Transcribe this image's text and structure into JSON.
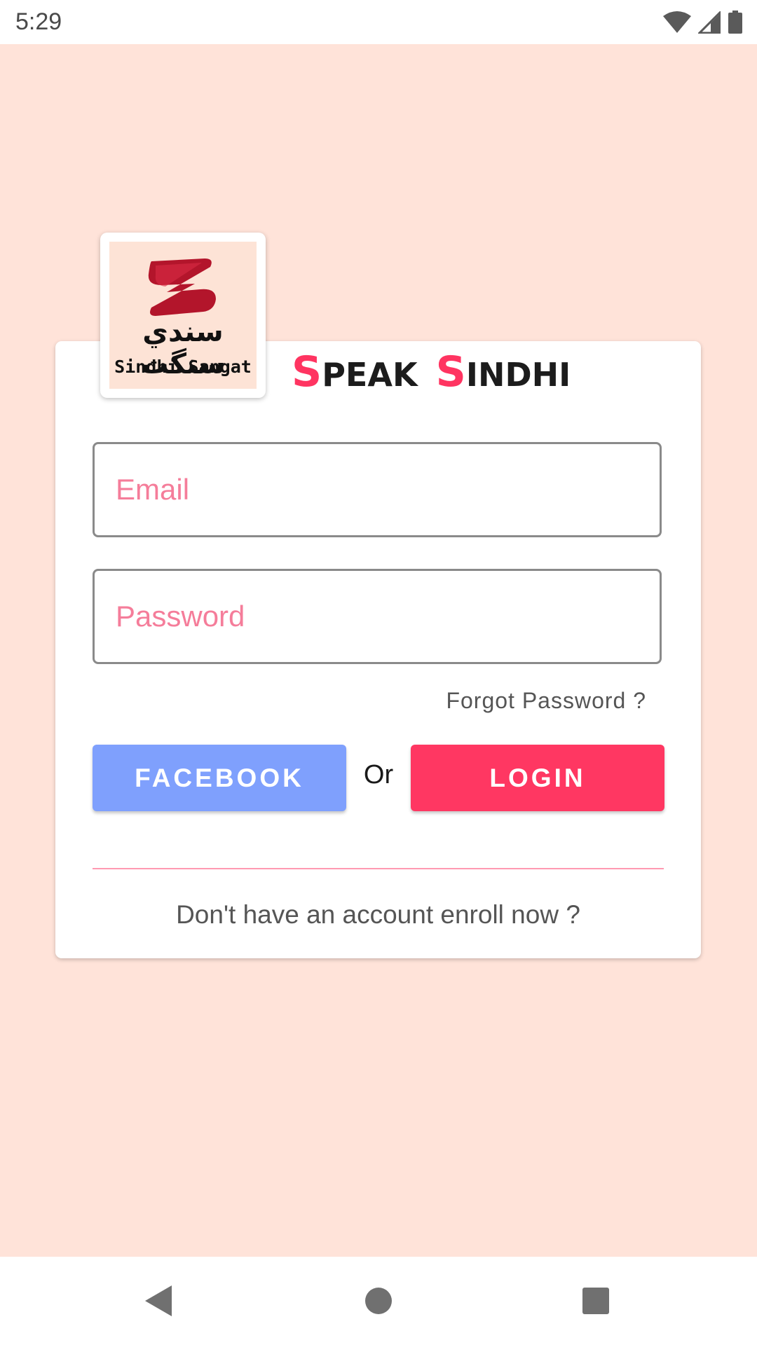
{
  "status_bar": {
    "time": "5:29",
    "icons": [
      "wifi-icon",
      "signal-icon",
      "battery-icon"
    ]
  },
  "logo": {
    "arabic_text": "سندي سنگت",
    "latin_text": "Sindhi Sangat",
    "mark_color": "#b3152b"
  },
  "title": {
    "word1_initial": "S",
    "word1_rest": "PEAK",
    "word2_initial": "S",
    "word2_rest": "INDHI",
    "accent_color": "#ff3461"
  },
  "form": {
    "email_placeholder": "Email",
    "password_placeholder": "Password",
    "forgot_password_label": "Forgot Password ?"
  },
  "actions": {
    "facebook_label": "FACEBOOK",
    "or_label": "Or",
    "login_label": "LOGIN",
    "facebook_color": "#7fa0fd",
    "login_color": "#ff3762"
  },
  "footer": {
    "enroll_label": "Don't have an account enroll now ?"
  },
  "nav_bar": {
    "icons": [
      "back-icon",
      "home-icon",
      "recents-icon"
    ]
  },
  "colors": {
    "background": "#ffe3d9",
    "card": "#ffffff"
  }
}
